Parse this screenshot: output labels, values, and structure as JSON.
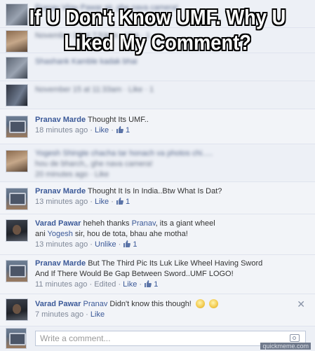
{
  "meme": {
    "title_line1": "If U Don't Know UMF. Why U",
    "title_line2": "Liked My Comment?"
  },
  "blurred": {
    "c1_name": "Pranav Vijay Pawar",
    "c1_text": "sir, ghe nava camera!",
    "c1_meta": "November 14 at 7:53pm · Like · 1",
    "c2_name": "Shashank Kamble",
    "c2_text": "kadak bhai",
    "c2_meta": "November 15 at 11:33am · Like · 1",
    "c4_name": "Yogesh Shingte",
    "c4_text": "chacha tar honach va photos chi.....",
    "c4_text2": "hou de bharch,, ghe nava camera!",
    "c4_meta": "20 minutes ago · Like"
  },
  "comments": [
    {
      "name": "Pranav Marde",
      "text": "Thought Its UMF..",
      "time": "18 minutes ago",
      "action": "Like",
      "likes": "1"
    },
    {
      "name": "Pranav Marde",
      "text": "Thought It Is In India..Btw What Is Dat?",
      "time": "13 minutes ago",
      "action": "Like",
      "likes": "1"
    },
    {
      "name": "Varad Pawar",
      "text_a": "heheh thanks",
      "mention_1": "Pranav",
      "text_b": ", its a giant wheel",
      "text_c": "ani",
      "mention_2": "Yogesh",
      "text_d": "sir, hou de tota, bhau ahe motha!",
      "time": "13 minutes ago",
      "action": "Unlike",
      "likes": "1"
    },
    {
      "name": "Pranav Marde",
      "text_line1": "But The Third Pic Its Luk Like Wheel Having Sword",
      "text_line2": "And If There Would Be Gap Between Sword..UMF LOGO!",
      "time": "11 minutes ago",
      "edited": "Edited",
      "action": "Like",
      "likes": "1"
    },
    {
      "name": "Varad Pawar",
      "mention": "Pranav",
      "text": "Didn't know this though!",
      "time": "7 minutes ago",
      "action": "Like",
      "close": "✕"
    }
  ],
  "composer": {
    "placeholder": "Write a comment..."
  },
  "watermark": "quickmeme.com",
  "icons": {
    "like": "thumbs-up-icon",
    "camera": "camera-icon",
    "close": "close-icon",
    "emoji": "smiley-icon"
  },
  "colors": {
    "link": "#3b5998",
    "meta": "#808999",
    "background": "#edf0f6"
  }
}
